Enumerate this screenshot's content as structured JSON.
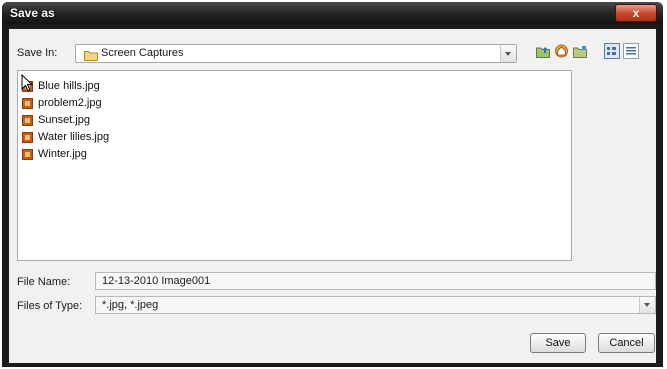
{
  "window": {
    "title": "Save as",
    "close_label": "x"
  },
  "save_in": {
    "label": "Save In:",
    "value": "Screen Captures"
  },
  "toolbar": {
    "icons": [
      "up-folder-icon",
      "home-icon",
      "new-folder-icon",
      "list-view-icon",
      "details-view-icon"
    ]
  },
  "files": [
    "Blue hills.jpg",
    "problem2.jpg",
    "Sunset.jpg",
    "Water lilies.jpg",
    "Winter.jpg"
  ],
  "file_name": {
    "label": "File Name:",
    "value": "12-13-2010 Image001"
  },
  "file_type": {
    "label": "Files of Type:",
    "value": "*.jpg, *.jpeg"
  },
  "buttons": {
    "save": "Save",
    "cancel": "Cancel"
  }
}
